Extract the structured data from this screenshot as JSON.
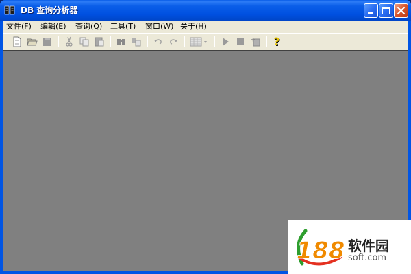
{
  "window": {
    "title": "DB 查询分析器"
  },
  "menubar": {
    "items": [
      {
        "label": "文件(F)"
      },
      {
        "label": "编辑(E)"
      },
      {
        "label": "查询(Q)"
      },
      {
        "label": "工具(T)"
      },
      {
        "label": "窗口(W)"
      },
      {
        "label": "关于(H)"
      }
    ]
  },
  "toolbar": {
    "buttons": [
      {
        "icon": "new-query-icon",
        "enabled": true
      },
      {
        "icon": "open-folder-icon",
        "enabled": true
      },
      {
        "icon": "save-icon",
        "enabled": false
      },
      {
        "icon": "cut-icon",
        "enabled": false
      },
      {
        "icon": "copy-icon",
        "enabled": false
      },
      {
        "icon": "paste-icon",
        "enabled": false
      },
      {
        "icon": "find-icon",
        "enabled": false
      },
      {
        "icon": "replace-icon",
        "enabled": false
      },
      {
        "icon": "undo-icon",
        "enabled": false
      },
      {
        "icon": "redo-icon",
        "enabled": false
      },
      {
        "icon": "results-grid-icon",
        "enabled": false
      },
      {
        "icon": "execute-icon",
        "enabled": false
      },
      {
        "icon": "stop-icon",
        "enabled": false
      },
      {
        "icon": "parse-query-icon",
        "enabled": false
      },
      {
        "icon": "help-icon",
        "enabled": true
      }
    ]
  },
  "watermark": {
    "logo_number": "188",
    "name": "软件园",
    "domain": "soft.com"
  },
  "colors": {
    "titlebar": "#0a5ee8",
    "menubar": "#ece9d8",
    "workspace": "#808080",
    "help_icon": "#c8a800"
  }
}
